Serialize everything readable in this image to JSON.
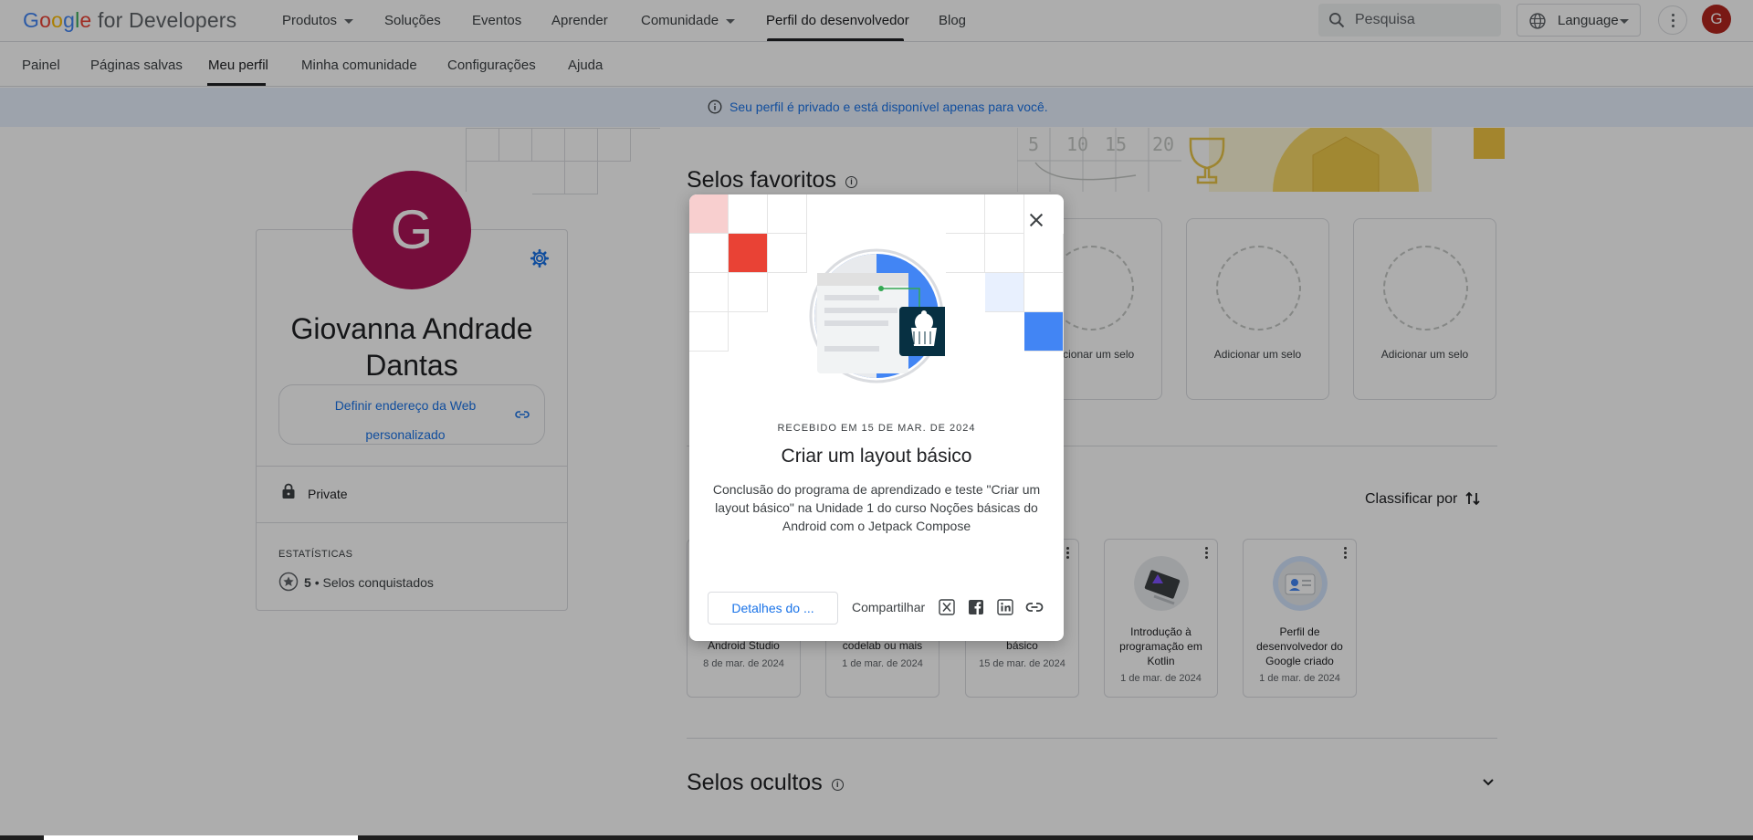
{
  "header": {
    "logo_google": "Google",
    "logo_rest": " for Developers",
    "nav": [
      {
        "label": "Produtos"
      },
      {
        "label": "Soluções"
      },
      {
        "label": "Eventos"
      },
      {
        "label": "Aprender"
      },
      {
        "label": "Comunidade"
      },
      {
        "label": "Perfil do desenvolvedor"
      },
      {
        "label": "Blog"
      }
    ],
    "search_placeholder": "Pesquisa",
    "language_label": "Language",
    "avatar_letter": "G"
  },
  "subnav": {
    "items": [
      {
        "label": "Painel"
      },
      {
        "label": "Páginas salvas"
      },
      {
        "label": "Meu perfil"
      },
      {
        "label": "Minha comunidade"
      },
      {
        "label": "Configurações"
      },
      {
        "label": "Ajuda"
      }
    ],
    "active": "Meu perfil"
  },
  "banner": {
    "text": "Seu perfil é privado e está disponível apenas para você."
  },
  "profile": {
    "avatar_letter": "G",
    "name": "Giovanna Andrade Dantas",
    "web_address_button": "Definir endereço da Web personalizado",
    "privacy": "Private",
    "stats_title": "ESTATÍSTICAS",
    "stats_count": "5",
    "stats_label": "• Selos conquistados"
  },
  "favorites": {
    "title": "Selos favoritos",
    "slots": [
      {
        "label": "Adicionar um selo"
      },
      {
        "label": "Adicionar um selo"
      },
      {
        "label": "Adicionar um selo"
      }
    ]
  },
  "badges": {
    "sort_label": "Classificar por",
    "cards": [
      {
        "title": "Android Studio",
        "date": "8 de mar. de 2024"
      },
      {
        "title": "codelab ou mais",
        "date": "1 de mar. de 2024"
      },
      {
        "title": "básico",
        "date": "15 de mar. de 2024"
      },
      {
        "title": "Introdução à programação em Kotlin",
        "date": "1 de mar. de 2024"
      },
      {
        "title": "Perfil de desenvolvedor do Google criado",
        "date": "1 de mar. de 2024"
      }
    ]
  },
  "hidden": {
    "title": "Selos ocultos"
  },
  "dialog": {
    "received": "RECEBIDO EM 15 DE MAR. DE 2024",
    "title": "Criar um layout básico",
    "description": "Conclusão do programa de aprendizado e teste \"Criar um layout básico\" na Unidade 1 do curso Noções básicas do Android com o Jetpack Compose",
    "details_button": "Detalhes do ...",
    "share_label": "Compartilhar",
    "share_icons": [
      "x-icon",
      "facebook-icon",
      "linkedin-icon",
      "link-icon"
    ]
  },
  "colors": {
    "accent": "#1a73e8",
    "avatar": "#ad1457",
    "top_avatar": "#b3261e",
    "banner_bg": "#e8f0fe"
  }
}
